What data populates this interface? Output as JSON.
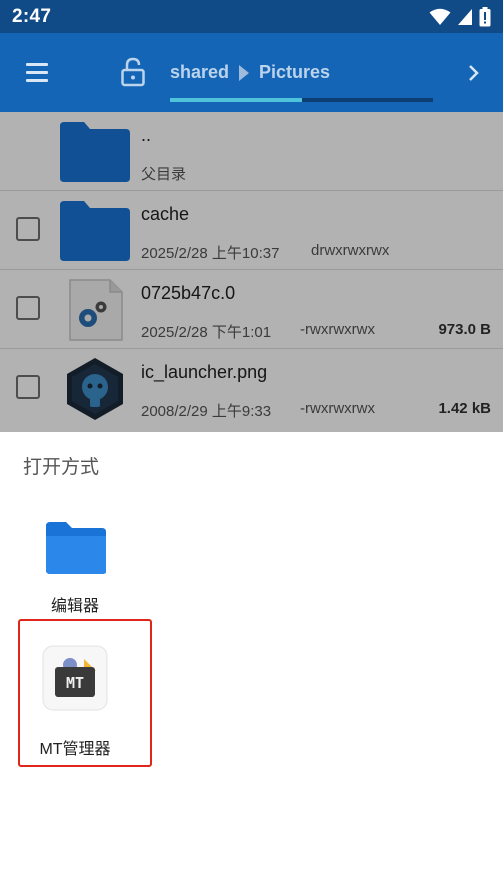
{
  "status_bar": {
    "time": "2:47",
    "icons": [
      "wifi-icon",
      "signal-icon",
      "battery-icon"
    ]
  },
  "app_bar": {
    "crumbs": [
      "shared",
      "Pictures"
    ],
    "tab_progress": 0.5
  },
  "files": [
    {
      "name": "..",
      "sub": "父目录",
      "icon": "folder-icon",
      "has_checkbox": false
    },
    {
      "name": "cache",
      "date": "2025/2/28 上午10:37",
      "perm": "drwxrwxrwx",
      "size": "",
      "icon": "folder-icon",
      "has_checkbox": true
    },
    {
      "name": "0725b47c.0",
      "date": "2025/2/28 下午1:01",
      "perm": "-rwxrwxrwx",
      "size": "973.0 B",
      "icon": "gear-file-icon",
      "has_checkbox": true
    },
    {
      "name": "ic_launcher.png",
      "date": "2008/2/29 上午9:33",
      "perm": "-rwxrwxrwx",
      "size": "1.42 kB",
      "icon": "launcher-image-icon",
      "has_checkbox": true
    }
  ],
  "sheet": {
    "title": "打开方式",
    "apps": [
      {
        "label": "编辑器",
        "icon": "folder-icon"
      },
      {
        "label": "MT管理器",
        "icon": "mt-manager-icon",
        "icon_text": "MT"
      }
    ]
  },
  "colors": {
    "appbar": "#1565b6",
    "statusbar": "#104a87",
    "accent": "#4fc3d9",
    "highlight": "#e0261b",
    "folder": "#1a73d6"
  }
}
